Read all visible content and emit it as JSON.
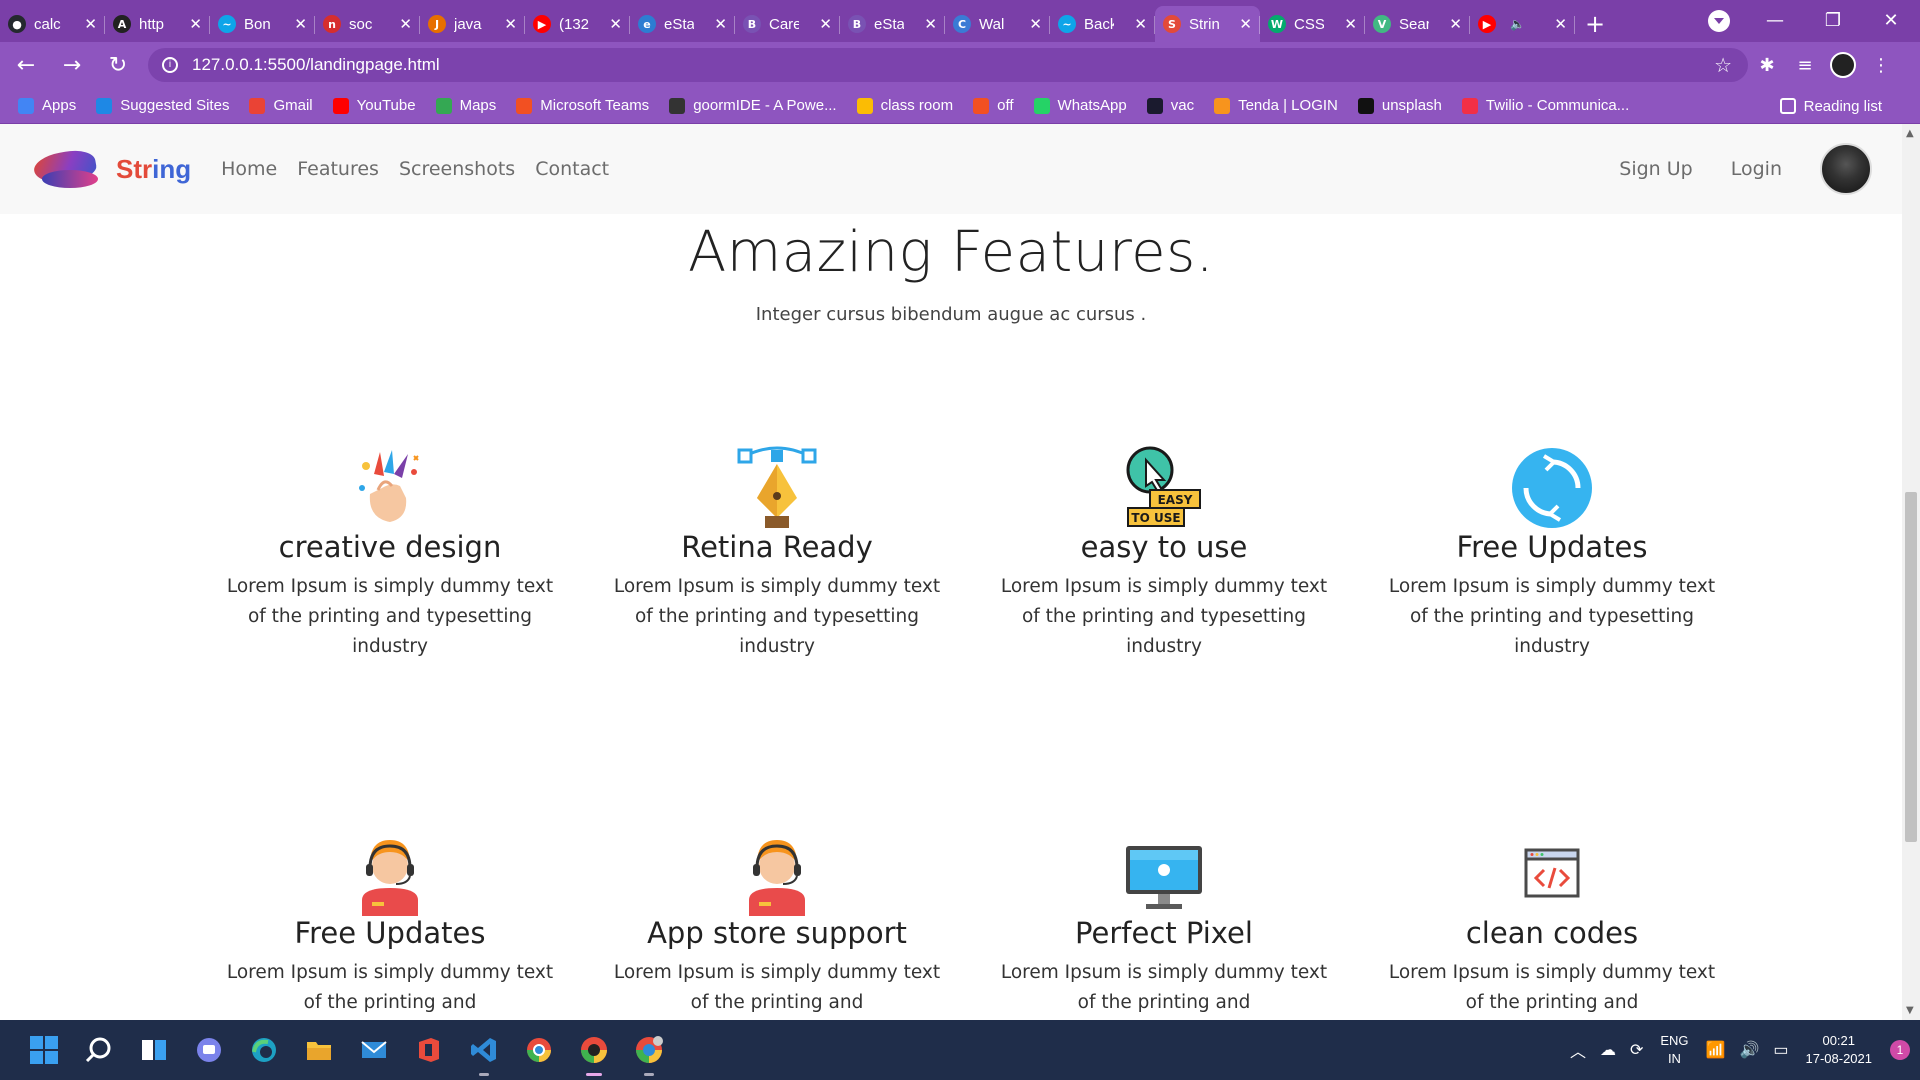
{
  "browser": {
    "tabs": [
      {
        "title": "calc",
        "fav_color": "#24292e",
        "fav_glyph": "●"
      },
      {
        "title": "http",
        "fav_color": "#222222",
        "fav_glyph": "A"
      },
      {
        "title": "Bon",
        "fav_color": "#0ea5e9",
        "fav_glyph": "~"
      },
      {
        "title": "soc",
        "fav_color": "#d62e2e",
        "fav_glyph": "n"
      },
      {
        "title": "java",
        "fav_color": "#e76f00",
        "fav_glyph": "J"
      },
      {
        "title": "(132",
        "fav_color": "#ff0000",
        "fav_glyph": "▶"
      },
      {
        "title": "eSta",
        "fav_color": "#2d7dd2",
        "fav_glyph": "e"
      },
      {
        "title": "Care",
        "fav_color": "#7952b3",
        "fav_glyph": "B"
      },
      {
        "title": "eSta",
        "fav_color": "#7952b3",
        "fav_glyph": "B"
      },
      {
        "title": "Wal",
        "fav_color": "#3a7bd5",
        "fav_glyph": "C"
      },
      {
        "title": "Back",
        "fav_color": "#0ea5e9",
        "fav_glyph": "~"
      },
      {
        "title": "Strin",
        "fav_color": "#e34a3a",
        "fav_glyph": "S"
      },
      {
        "title": "CSS",
        "fav_color": "#04aa6d",
        "fav_glyph": "W"
      },
      {
        "title": "Sear",
        "fav_color": "#41b883",
        "fav_glyph": "V"
      },
      {
        "title": "",
        "fav_color": "#ff0000",
        "fav_glyph": "▶"
      }
    ],
    "active_tab_index": 11,
    "url": "127.0.0.1:5500/landingpage.html",
    "bookmarks": [
      {
        "label": "Apps",
        "color": "#4285f4"
      },
      {
        "label": "Suggested Sites",
        "color": "#1e88e5"
      },
      {
        "label": "Gmail",
        "color": "#ea4335"
      },
      {
        "label": "YouTube",
        "color": "#ff0000"
      },
      {
        "label": "Maps",
        "color": "#34a853"
      },
      {
        "label": "Microsoft Teams",
        "color": "#f25022"
      },
      {
        "label": "goormIDE - A Powe...",
        "color": "#333333"
      },
      {
        "label": "class room",
        "color": "#fbbc04"
      },
      {
        "label": "off",
        "color": "#f25022"
      },
      {
        "label": "WhatsApp",
        "color": "#25d366"
      },
      {
        "label": "vac",
        "color": "#1a1a2e"
      },
      {
        "label": "Tenda | LOGIN",
        "color": "#f7941d"
      },
      {
        "label": "unsplash",
        "color": "#111111"
      },
      {
        "label": "Twilio - Communica...",
        "color": "#f22f46"
      }
    ],
    "reading_list": "Reading list"
  },
  "site": {
    "brand_part1": "Str",
    "brand_part2": "ing",
    "nav": [
      "Home",
      "Features",
      "Screenshots",
      "Contact"
    ],
    "signup": "Sign Up",
    "login": "Login"
  },
  "hero": {
    "title": "Amazing Features.",
    "subtitle": "Integer cursus bibendum augue ac cursus ."
  },
  "features": [
    {
      "title": "creative design",
      "desc": "Lorem Ipsum is simply dummy text of the printing and typesetting industry",
      "icon": "creative-design-icon"
    },
    {
      "title": "Retina Ready",
      "desc": "Lorem Ipsum is simply dummy text of the printing and typesetting industry",
      "icon": "pen-tool-icon"
    },
    {
      "title": "easy to use",
      "desc": "Lorem Ipsum is simply dummy text of the printing and typesetting industry",
      "icon": "easy-to-use-icon"
    },
    {
      "title": "Free Updates",
      "desc": "Lorem Ipsum is simply dummy text of the printing and typesetting industry",
      "icon": "refresh-icon"
    },
    {
      "title": "Free Updates",
      "desc": "Lorem Ipsum is simply dummy text of the printing and",
      "icon": "support-agent-icon"
    },
    {
      "title": "App store support",
      "desc": "Lorem Ipsum is simply dummy text of the printing and",
      "icon": "support-agent-icon"
    },
    {
      "title": "Perfect Pixel",
      "desc": "Lorem Ipsum is simply dummy text of the printing and",
      "icon": "monitor-icon"
    },
    {
      "title": "clean codes",
      "desc": "Lorem Ipsum is simply dummy text of the printing and",
      "icon": "code-window-icon"
    }
  ],
  "taskbar": {
    "lang_top": "ENG",
    "lang_bottom": "IN",
    "time": "00:21",
    "date": "17-08-2021",
    "notifications": "1"
  },
  "easy_badge": {
    "line1": "EASY",
    "line2": "TO USE"
  }
}
